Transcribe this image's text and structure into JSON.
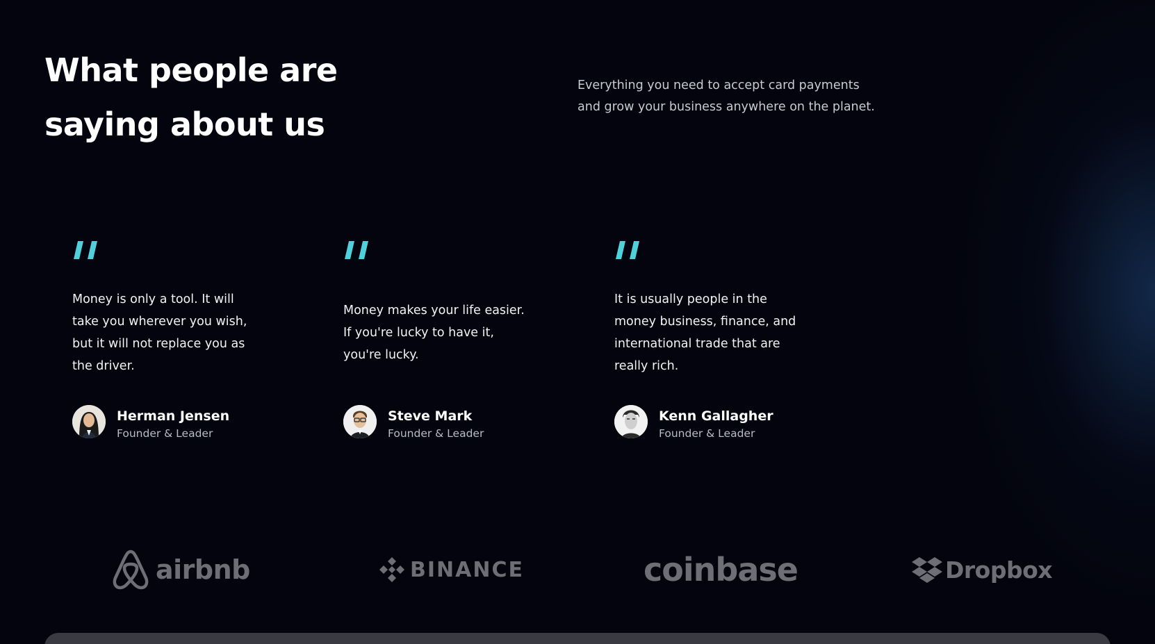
{
  "section": {
    "heading_line1": "What people are",
    "heading_line2": "saying about us",
    "intro_line1": "Everything you need to accept card payments",
    "intro_line2": "and grow your business anywhere on the planet."
  },
  "testimonials": [
    {
      "quote_lines": [
        "Money is only a tool. It will",
        "take you wherever you wish,",
        "but it will not replace you as",
        "the driver."
      ],
      "name": "Herman Jensen",
      "role": "Founder & Leader"
    },
    {
      "quote_lines": [
        "Money makes your life easier.",
        "If you're lucky to have it,",
        "you're lucky."
      ],
      "name": "Steve Mark",
      "role": "Founder & Leader"
    },
    {
      "quote_lines": [
        "It is usually people in the",
        "money business, finance, and",
        "international trade that are",
        "really rich."
      ],
      "name": "Kenn Gallagher",
      "role": "Founder & Leader"
    }
  ],
  "logos": [
    {
      "name": "airbnb",
      "icon": "airbnb-icon"
    },
    {
      "name": "BINANCE",
      "icon": "binance-icon"
    },
    {
      "name": "coinbase",
      "icon": "coinbase-icon"
    },
    {
      "name": "Dropbox",
      "icon": "dropbox-icon"
    }
  ],
  "colors": {
    "background": "#03040d",
    "quote_accent": "#4fd1dc",
    "logo_gray": "#6e6f76"
  }
}
